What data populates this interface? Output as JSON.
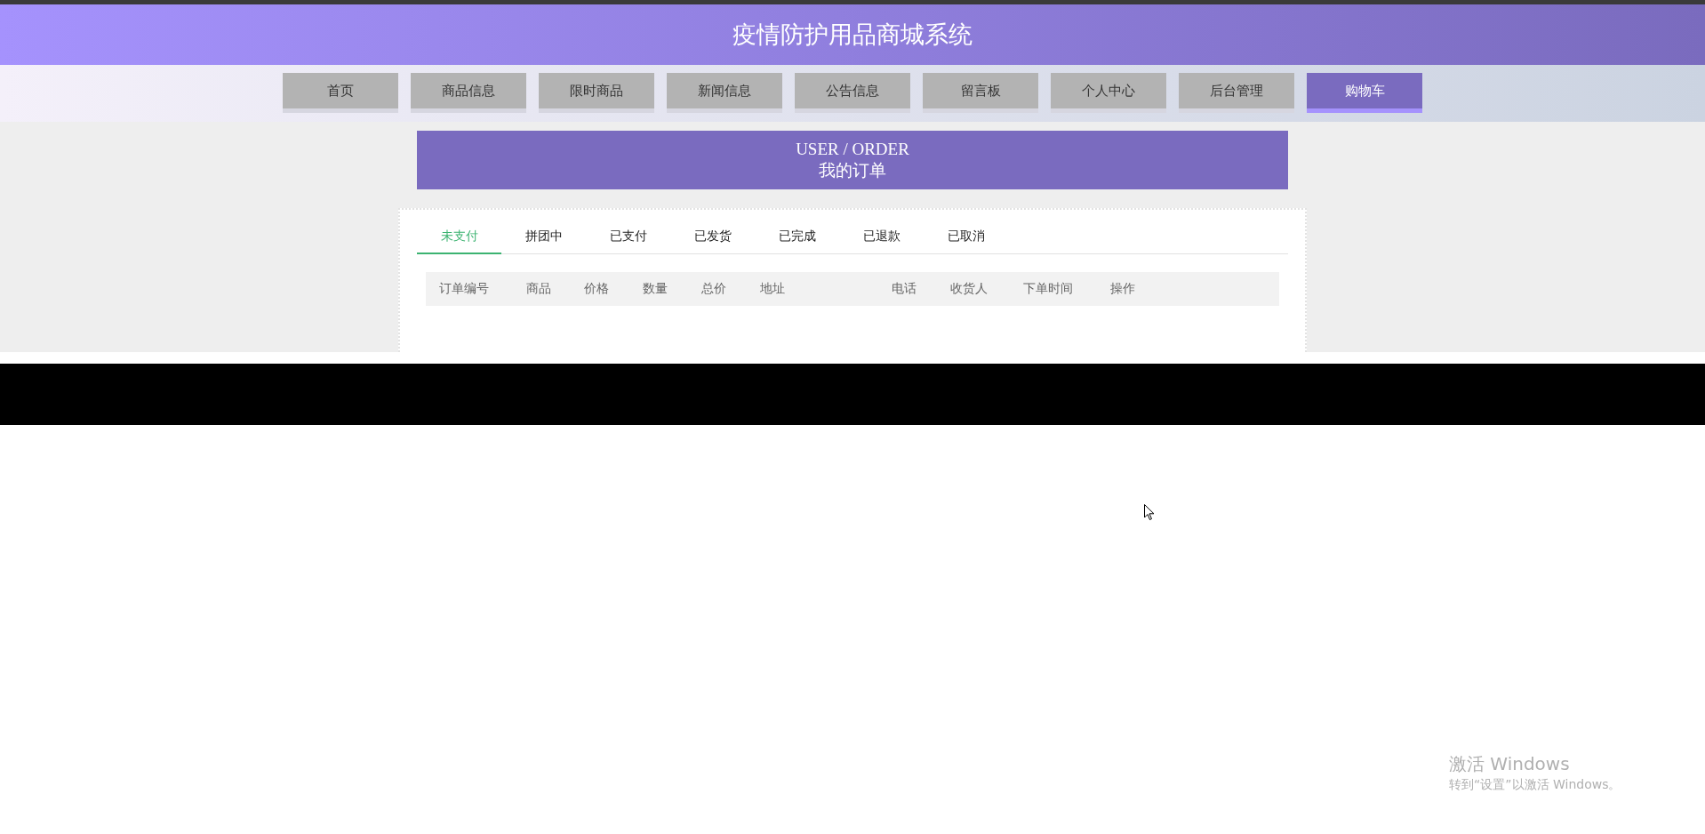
{
  "header": {
    "title": "疫情防护用品商城系统"
  },
  "nav": [
    {
      "label": "首页",
      "selected": false
    },
    {
      "label": "商品信息",
      "selected": false
    },
    {
      "label": "限时商品",
      "selected": false
    },
    {
      "label": "新闻信息",
      "selected": false
    },
    {
      "label": "公告信息",
      "selected": false
    },
    {
      "label": "留言板",
      "selected": false
    },
    {
      "label": "个人中心",
      "selected": false
    },
    {
      "label": "后台管理",
      "selected": false
    },
    {
      "label": "购物车",
      "selected": true
    }
  ],
  "banner": {
    "subtitle": "USER / ORDER",
    "title": "我的订单"
  },
  "order_tabs": [
    {
      "label": "未支付",
      "selected": true
    },
    {
      "label": "拼团中",
      "selected": false
    },
    {
      "label": "已支付",
      "selected": false
    },
    {
      "label": "已发货",
      "selected": false
    },
    {
      "label": "已完成",
      "selected": false
    },
    {
      "label": "已退款",
      "selected": false
    },
    {
      "label": "已取消",
      "selected": false
    }
  ],
  "table": {
    "columns": [
      "订单编号",
      "商品",
      "价格",
      "数量",
      "总价",
      "地址",
      "电话",
      "收货人",
      "下单时间",
      "操作"
    ]
  },
  "os_notice": {
    "title": "激活 Windows",
    "text": "转到“设置”以激活 Windows。"
  }
}
